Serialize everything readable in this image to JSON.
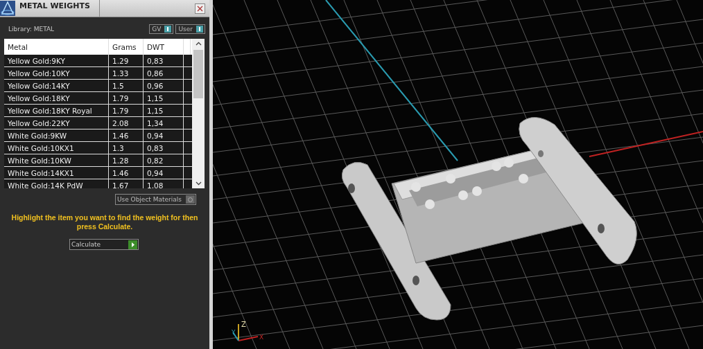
{
  "window": {
    "title": "METAL WEIGHTS"
  },
  "library": {
    "label": "Library: METAL"
  },
  "toggles": [
    {
      "label": "GV",
      "on": true
    },
    {
      "label": "User",
      "on": true
    }
  ],
  "table": {
    "columns": [
      "Metal",
      "Grams",
      "DWT"
    ],
    "rows": [
      {
        "cells": [
          "Yellow Gold:9KY",
          "1.29",
          "0,83"
        ],
        "selected": false
      },
      {
        "cells": [
          "Yellow Gold:10KY",
          "1.33",
          "0,86"
        ],
        "selected": false
      },
      {
        "cells": [
          "Yellow Gold:14KY",
          "1.5",
          "0,96"
        ],
        "selected": false
      },
      {
        "cells": [
          "Yellow Gold:18KY",
          "1.79",
          "1,15"
        ],
        "selected": false
      },
      {
        "cells": [
          "Yellow Gold:18KY Royal",
          "1.79",
          "1,15"
        ],
        "selected": false
      },
      {
        "cells": [
          "Yellow Gold:22KY",
          "2.08",
          "1,34"
        ],
        "selected": false
      },
      {
        "cells": [
          "White Gold:9KW",
          "1.46",
          "0,94"
        ],
        "selected": false
      },
      {
        "cells": [
          "White Gold:10KX1",
          "1.3",
          "0,83"
        ],
        "selected": false
      },
      {
        "cells": [
          "White Gold:10KW",
          "1.28",
          "0,82"
        ],
        "selected": false
      },
      {
        "cells": [
          "White Gold:14KX1",
          "1.46",
          "0,94"
        ],
        "selected": false
      },
      {
        "cells": [
          "White Gold:14K PdW",
          "1.67",
          "1,08"
        ],
        "selected": false
      }
    ]
  },
  "use_object_materials": {
    "label": "Use Object Materials",
    "checked": false
  },
  "hint": "Highlight the item you want to find the weight for then press Calculate.",
  "calculate_button": {
    "label": "Calculate"
  },
  "viewport": {
    "axes": [
      "Z",
      "Y",
      "X"
    ]
  }
}
